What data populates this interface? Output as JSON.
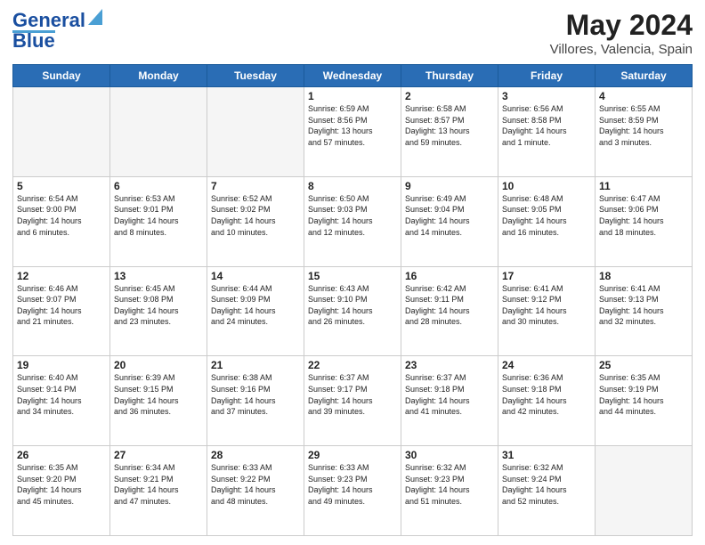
{
  "header": {
    "logo_line1": "General",
    "logo_line2": "Blue",
    "title": "May 2024",
    "subtitle": "Villores, Valencia, Spain"
  },
  "columns": [
    "Sunday",
    "Monday",
    "Tuesday",
    "Wednesday",
    "Thursday",
    "Friday",
    "Saturday"
  ],
  "weeks": [
    [
      {
        "num": "",
        "info": ""
      },
      {
        "num": "",
        "info": ""
      },
      {
        "num": "",
        "info": ""
      },
      {
        "num": "1",
        "info": "Sunrise: 6:59 AM\nSunset: 8:56 PM\nDaylight: 13 hours\nand 57 minutes."
      },
      {
        "num": "2",
        "info": "Sunrise: 6:58 AM\nSunset: 8:57 PM\nDaylight: 13 hours\nand 59 minutes."
      },
      {
        "num": "3",
        "info": "Sunrise: 6:56 AM\nSunset: 8:58 PM\nDaylight: 14 hours\nand 1 minute."
      },
      {
        "num": "4",
        "info": "Sunrise: 6:55 AM\nSunset: 8:59 PM\nDaylight: 14 hours\nand 3 minutes."
      }
    ],
    [
      {
        "num": "5",
        "info": "Sunrise: 6:54 AM\nSunset: 9:00 PM\nDaylight: 14 hours\nand 6 minutes."
      },
      {
        "num": "6",
        "info": "Sunrise: 6:53 AM\nSunset: 9:01 PM\nDaylight: 14 hours\nand 8 minutes."
      },
      {
        "num": "7",
        "info": "Sunrise: 6:52 AM\nSunset: 9:02 PM\nDaylight: 14 hours\nand 10 minutes."
      },
      {
        "num": "8",
        "info": "Sunrise: 6:50 AM\nSunset: 9:03 PM\nDaylight: 14 hours\nand 12 minutes."
      },
      {
        "num": "9",
        "info": "Sunrise: 6:49 AM\nSunset: 9:04 PM\nDaylight: 14 hours\nand 14 minutes."
      },
      {
        "num": "10",
        "info": "Sunrise: 6:48 AM\nSunset: 9:05 PM\nDaylight: 14 hours\nand 16 minutes."
      },
      {
        "num": "11",
        "info": "Sunrise: 6:47 AM\nSunset: 9:06 PM\nDaylight: 14 hours\nand 18 minutes."
      }
    ],
    [
      {
        "num": "12",
        "info": "Sunrise: 6:46 AM\nSunset: 9:07 PM\nDaylight: 14 hours\nand 21 minutes."
      },
      {
        "num": "13",
        "info": "Sunrise: 6:45 AM\nSunset: 9:08 PM\nDaylight: 14 hours\nand 23 minutes."
      },
      {
        "num": "14",
        "info": "Sunrise: 6:44 AM\nSunset: 9:09 PM\nDaylight: 14 hours\nand 24 minutes."
      },
      {
        "num": "15",
        "info": "Sunrise: 6:43 AM\nSunset: 9:10 PM\nDaylight: 14 hours\nand 26 minutes."
      },
      {
        "num": "16",
        "info": "Sunrise: 6:42 AM\nSunset: 9:11 PM\nDaylight: 14 hours\nand 28 minutes."
      },
      {
        "num": "17",
        "info": "Sunrise: 6:41 AM\nSunset: 9:12 PM\nDaylight: 14 hours\nand 30 minutes."
      },
      {
        "num": "18",
        "info": "Sunrise: 6:41 AM\nSunset: 9:13 PM\nDaylight: 14 hours\nand 32 minutes."
      }
    ],
    [
      {
        "num": "19",
        "info": "Sunrise: 6:40 AM\nSunset: 9:14 PM\nDaylight: 14 hours\nand 34 minutes."
      },
      {
        "num": "20",
        "info": "Sunrise: 6:39 AM\nSunset: 9:15 PM\nDaylight: 14 hours\nand 36 minutes."
      },
      {
        "num": "21",
        "info": "Sunrise: 6:38 AM\nSunset: 9:16 PM\nDaylight: 14 hours\nand 37 minutes."
      },
      {
        "num": "22",
        "info": "Sunrise: 6:37 AM\nSunset: 9:17 PM\nDaylight: 14 hours\nand 39 minutes."
      },
      {
        "num": "23",
        "info": "Sunrise: 6:37 AM\nSunset: 9:18 PM\nDaylight: 14 hours\nand 41 minutes."
      },
      {
        "num": "24",
        "info": "Sunrise: 6:36 AM\nSunset: 9:18 PM\nDaylight: 14 hours\nand 42 minutes."
      },
      {
        "num": "25",
        "info": "Sunrise: 6:35 AM\nSunset: 9:19 PM\nDaylight: 14 hours\nand 44 minutes."
      }
    ],
    [
      {
        "num": "26",
        "info": "Sunrise: 6:35 AM\nSunset: 9:20 PM\nDaylight: 14 hours\nand 45 minutes."
      },
      {
        "num": "27",
        "info": "Sunrise: 6:34 AM\nSunset: 9:21 PM\nDaylight: 14 hours\nand 47 minutes."
      },
      {
        "num": "28",
        "info": "Sunrise: 6:33 AM\nSunset: 9:22 PM\nDaylight: 14 hours\nand 48 minutes."
      },
      {
        "num": "29",
        "info": "Sunrise: 6:33 AM\nSunset: 9:23 PM\nDaylight: 14 hours\nand 49 minutes."
      },
      {
        "num": "30",
        "info": "Sunrise: 6:32 AM\nSunset: 9:23 PM\nDaylight: 14 hours\nand 51 minutes."
      },
      {
        "num": "31",
        "info": "Sunrise: 6:32 AM\nSunset: 9:24 PM\nDaylight: 14 hours\nand 52 minutes."
      },
      {
        "num": "",
        "info": ""
      }
    ]
  ]
}
